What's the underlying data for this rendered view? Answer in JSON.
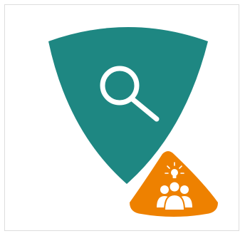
{
  "logo": {
    "shield_color": "#1e8782",
    "badge_color": "#ee8100",
    "icon_color": "#ffffff",
    "main_icon": "magnifying-glass-icon",
    "badge_icon": "team-idea-icon"
  }
}
